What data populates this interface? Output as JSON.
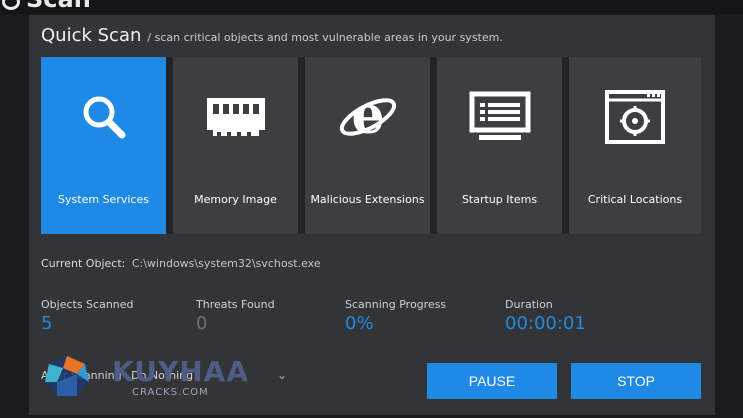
{
  "window": {
    "title_fragment": "Scan"
  },
  "heading": {
    "title": "Quick Scan",
    "subtitle": "/ scan critical objects and most vulnerable areas in your system."
  },
  "tiles": [
    {
      "label": "System Services",
      "icon": "search-icon",
      "active": true
    },
    {
      "label": "Memory Image",
      "icon": "memory-chip-icon",
      "active": false
    },
    {
      "label": "Malicious Extensions",
      "icon": "internet-explorer-icon",
      "active": false
    },
    {
      "label": "Startup Items",
      "icon": "monitor-list-icon",
      "active": false
    },
    {
      "label": "Critical Locations",
      "icon": "target-window-icon",
      "active": false
    }
  ],
  "current_object": {
    "label": "Current Object:",
    "value": "C:\\windows\\system32\\svchost.exe"
  },
  "stats": [
    {
      "label": "Objects Scanned",
      "value": "5"
    },
    {
      "label": "Threats Found",
      "value": "0"
    },
    {
      "label": "Scanning Progress",
      "value": "0%"
    },
    {
      "label": "Duration",
      "value": "00:00:01"
    }
  ],
  "after_scanning": {
    "label": "After Scanning",
    "value": "Do Nothing"
  },
  "buttons": {
    "pause": "PAUSE",
    "stop": "STOP"
  },
  "watermark": {
    "text": "KUYHAA",
    "sub": "CRACKS.COM"
  },
  "colors": {
    "accent": "#1e8ae6",
    "panel": "#323436",
    "tile": "#3c3e41"
  }
}
